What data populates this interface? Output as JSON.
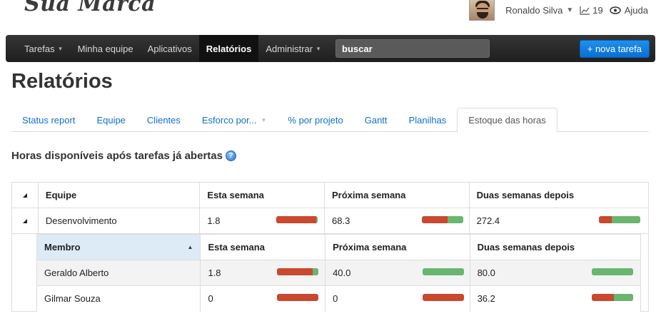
{
  "brand": "Sua Marca",
  "user": {
    "name": "Ronaldo Silva",
    "activity_count": "19",
    "help_label": "Ajuda"
  },
  "nav": {
    "items": [
      {
        "label": "Tarefas",
        "dropdown": true
      },
      {
        "label": "Minha equipe",
        "dropdown": false
      },
      {
        "label": "Aplicativos",
        "dropdown": false
      },
      {
        "label": "Relatórios",
        "dropdown": false,
        "active": true
      },
      {
        "label": "Administrar",
        "dropdown": true
      }
    ],
    "search_value": "buscar",
    "new_task_label": "+ nova tarefa"
  },
  "page_title": "Relatórios",
  "tabs": [
    {
      "label": "Status report"
    },
    {
      "label": "Equipe"
    },
    {
      "label": "Clientes"
    },
    {
      "label": "Esforco por..."
    },
    {
      "label": "% por projeto"
    },
    {
      "label": "Gantt"
    },
    {
      "label": "Planilhas"
    },
    {
      "label": "Estoque das horas",
      "active": true
    }
  ],
  "section_title": "Horas disponíveis após tarefas já abertas",
  "table": {
    "headers": {
      "team": "Equipe",
      "this_week": "Esta semana",
      "next_week": "Próxima semana",
      "two_weeks": "Duas semanas depois"
    },
    "group": {
      "name": "Desenvolvimento",
      "this_week": "1.8",
      "next_week": "68.3",
      "two_weeks": "272.4",
      "bars": {
        "this_week_red": 0.95,
        "next_week_red": 0.62,
        "two_weeks_red": 0.32
      }
    },
    "sub_headers": {
      "member": "Membro",
      "this_week": "Esta semana",
      "next_week": "Próxima semana",
      "two_weeks": "Duas semanas depois"
    },
    "members": [
      {
        "name": "Geraldo Alberto",
        "this_week": "1.8",
        "next_week": "40.0",
        "two_weeks": "80.0",
        "bars": {
          "this_week_red": 0.86,
          "next_week_red": 0.0,
          "two_weeks_red": 0.0
        }
      },
      {
        "name": "Gilmar Souza",
        "this_week": "0",
        "next_week": "0",
        "two_weeks": "36.2",
        "bars": {
          "this_week_red": 1.0,
          "next_week_red": 1.0,
          "two_weeks_red": 0.55
        }
      }
    ]
  },
  "colors": {
    "bar_used": "#c9482e",
    "bar_free": "#6ab56f",
    "accent": "#0f6fc6",
    "primary_button": "#1e90ef"
  }
}
